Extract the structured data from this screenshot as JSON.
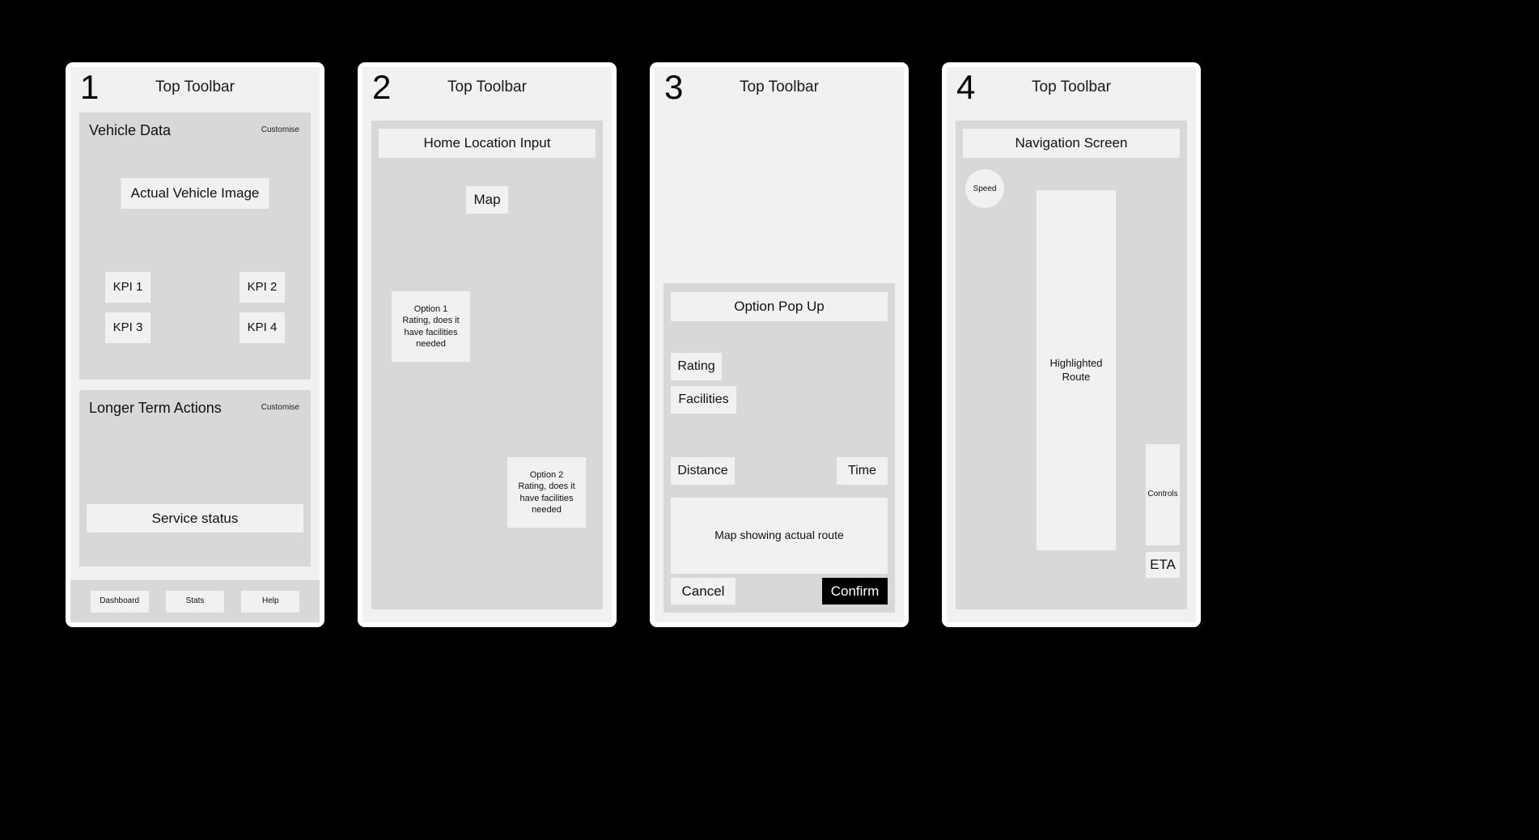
{
  "screens": [
    {
      "number": "1",
      "toolbar_title": "Top Toolbar",
      "cards": [
        {
          "title": "Vehicle Data",
          "customise_label": "Customise",
          "vehicle_image_label": "Actual Vehicle Image",
          "kpis": [
            {
              "label": "KPI 1"
            },
            {
              "label": "KPI 2"
            },
            {
              "label": "KPI 3"
            },
            {
              "label": "KPI 4"
            }
          ]
        },
        {
          "title": "Longer Term Actions",
          "customise_label": "Customise",
          "service_status_label": "Service status"
        }
      ],
      "bottom_nav": [
        {
          "label": "Dashboard"
        },
        {
          "label": "Stats"
        },
        {
          "label": "Help"
        }
      ]
    },
    {
      "number": "2",
      "toolbar_title": "Top Toolbar",
      "home_location_input": "Home Location Input",
      "map_label": "Map",
      "options": [
        {
          "title": "Option 1",
          "line2": "Rating, does it",
          "line3": "have facilities",
          "line4": "needed"
        },
        {
          "title": "Option 2",
          "line2": "Rating, does it",
          "line3": "have facilities",
          "line4": "needed"
        }
      ]
    },
    {
      "number": "3",
      "toolbar_title": "Top Toolbar",
      "popup_title": "Option Pop Up",
      "chips": [
        {
          "label": "Rating"
        },
        {
          "label": "Facilities"
        },
        {
          "label": "Distance"
        },
        {
          "label": "Time"
        }
      ],
      "map_label": "Map showing actual route",
      "cancel_label": "Cancel",
      "confirm_label": "Confirm"
    },
    {
      "number": "4",
      "toolbar_title": "Top Toolbar",
      "header_label": "Navigation Screen",
      "speed_label": "Speed",
      "route_line1": "Highlighted",
      "route_line2": "Route",
      "controls_label": "Controls",
      "eta_label": "ETA"
    }
  ],
  "colors": {
    "background": "#000000",
    "frame": "#000000",
    "screen": "#f1f1f1",
    "panel": "#d8d8d8",
    "box": "#f1f1f1",
    "primary_button": "#000000",
    "primary_button_text": "#ffffff",
    "text": "#111111"
  }
}
